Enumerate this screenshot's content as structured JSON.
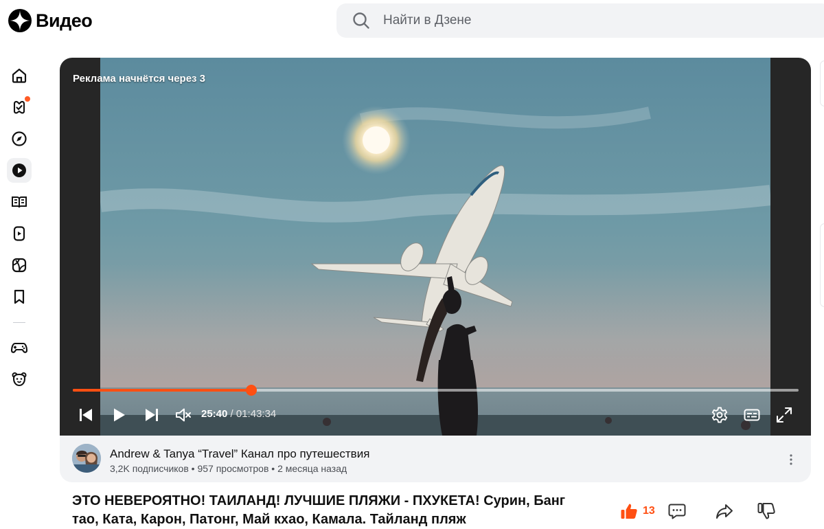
{
  "header": {
    "logo_text": "Видео",
    "search_placeholder": "Найти в Дзене"
  },
  "sidebar": {
    "items": [
      {
        "icon": "home-icon",
        "active": false
      },
      {
        "icon": "subscriptions-icon",
        "active": false,
        "notification": true
      },
      {
        "icon": "compass-icon",
        "active": false
      },
      {
        "icon": "video-play-icon",
        "active": true
      },
      {
        "icon": "articles-book-icon",
        "active": false
      },
      {
        "icon": "shorts-icon",
        "active": false
      },
      {
        "icon": "sport-ball-icon",
        "active": false
      },
      {
        "icon": "bookmark-icon",
        "active": false
      },
      {
        "icon": "gamepad-icon",
        "active": false
      },
      {
        "icon": "kids-bear-icon",
        "active": false
      }
    ]
  },
  "player": {
    "ad_notice": "Реклама начнётся через 3",
    "current_time": "25:40",
    "total_time": " / 01:43:34",
    "progress_fraction": 0.246,
    "accent_color": "#ff4f12"
  },
  "channel": {
    "name": "Andrew & Tanya “Travel” Канал про путешествия",
    "meta": "3,2K подписчиков • 957 просмотров • 2 месяца назад"
  },
  "video": {
    "title": "ЭТО НЕВЕРОЯТНО! ТАИЛАНД! ЛУЧШИЕ ПЛЯЖИ - ПХУКЕТА! Сурин, Банг тао, Ката, Карон, Патонг, Май кхао, Камала. Тайланд пляж",
    "likes": "13"
  }
}
